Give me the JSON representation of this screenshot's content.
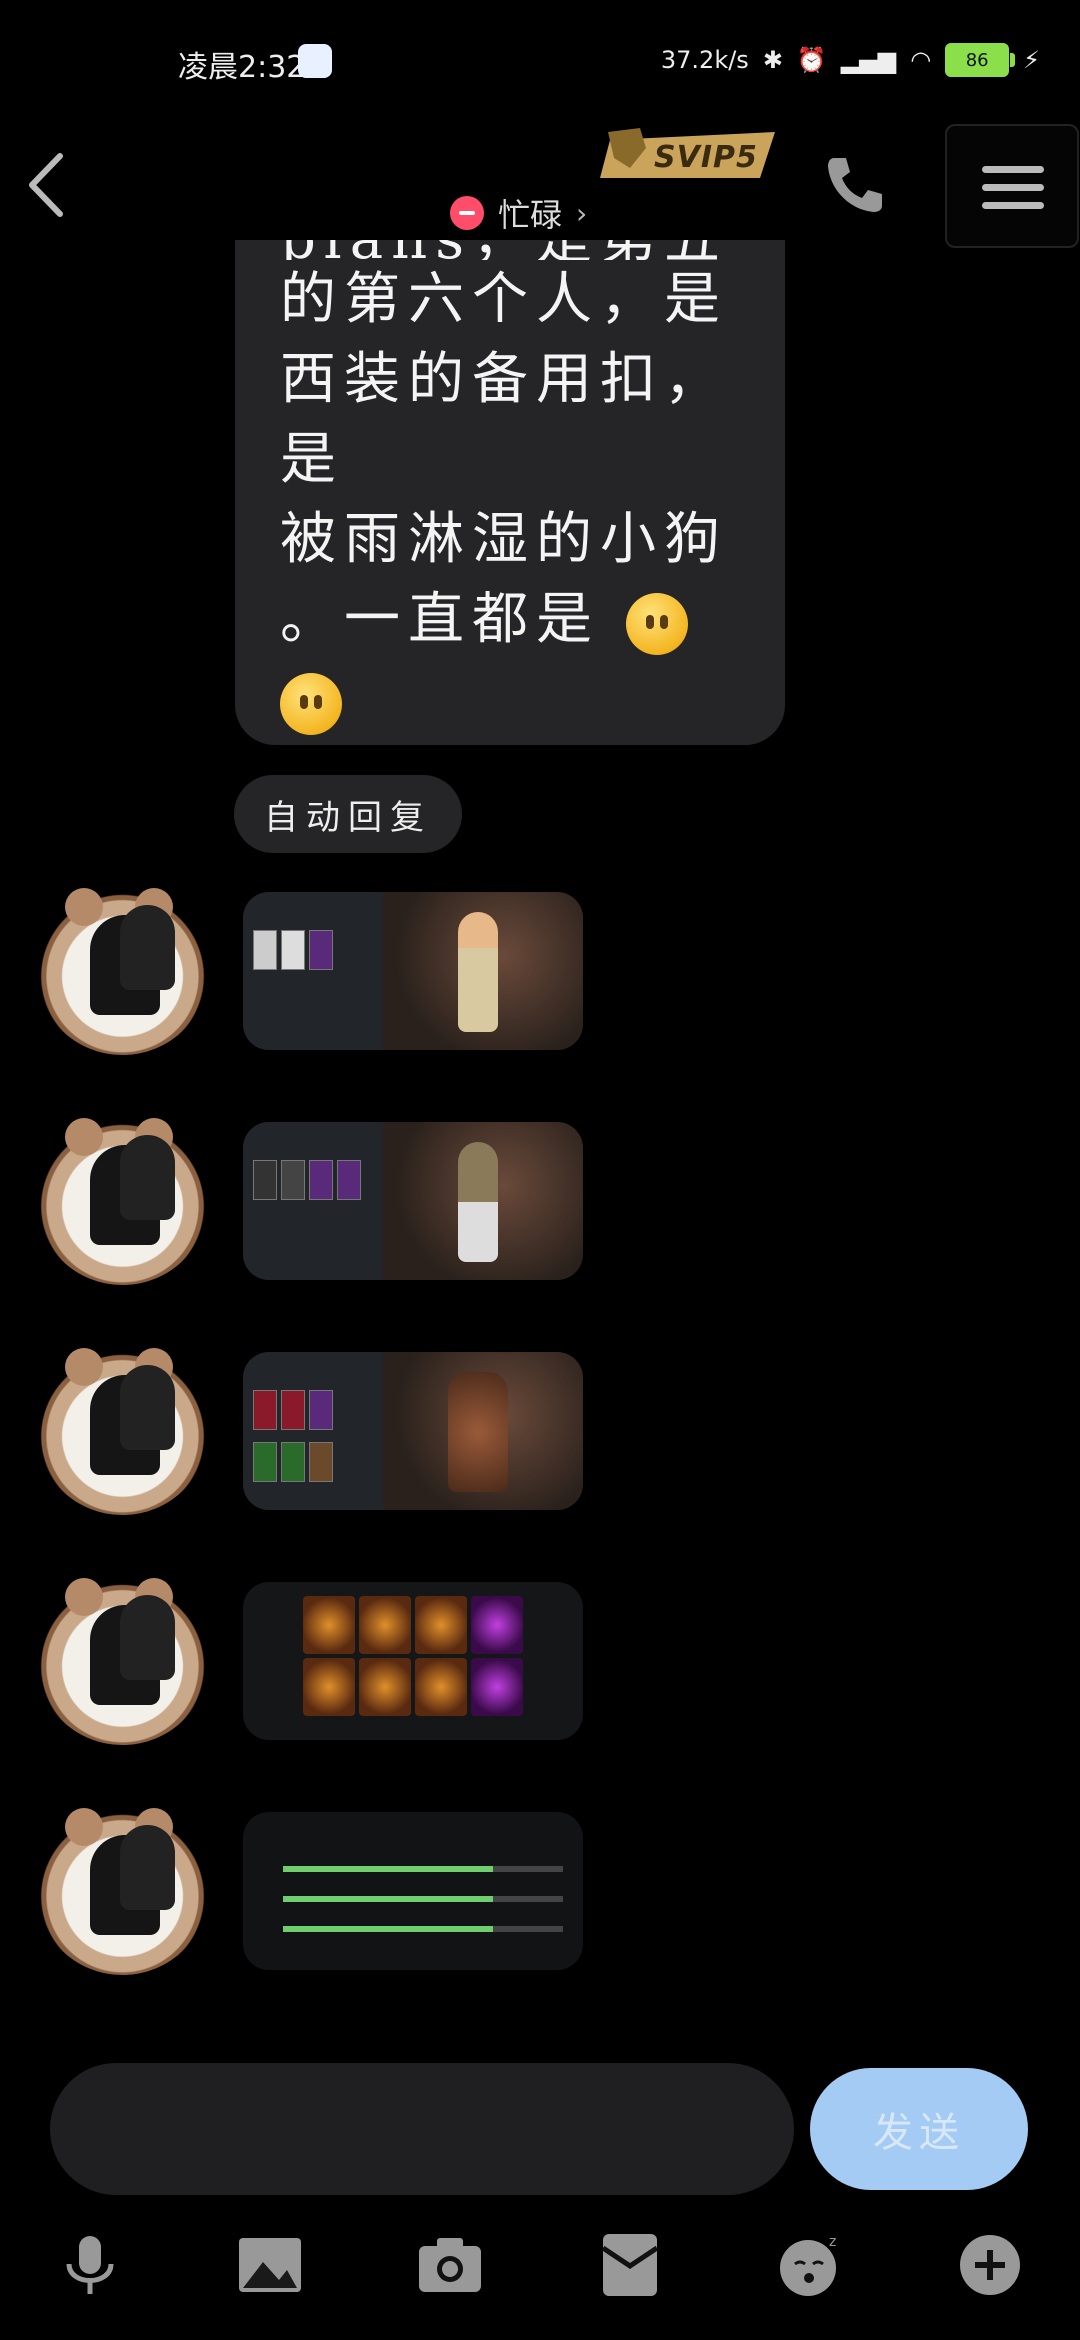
{
  "status_bar": {
    "time": "凌晨2:32",
    "network_speed": "37.2k/s",
    "battery": "86"
  },
  "header": {
    "status_text": "忙碌",
    "badge": "SVIP5"
  },
  "bubble": {
    "text_cut": "plans，是第五都",
    "text_lines": [
      "的第六个人，是",
      "西装的备用扣，是",
      "被雨淋湿的小狗",
      "。一直都是"
    ]
  },
  "auto_reply": "自动回复",
  "messages": [
    {
      "kind": "game-wardrobe-female"
    },
    {
      "kind": "game-wardrobe-male"
    },
    {
      "kind": "game-wardrobe-monster"
    },
    {
      "kind": "game-shop"
    },
    {
      "kind": "game-progress"
    }
  ],
  "composer": {
    "send_label": "发送"
  },
  "toolbar": [
    "mic-icon",
    "image-icon",
    "camera-icon",
    "red-packet-icon",
    "emoji-icon",
    "plus-icon"
  ]
}
